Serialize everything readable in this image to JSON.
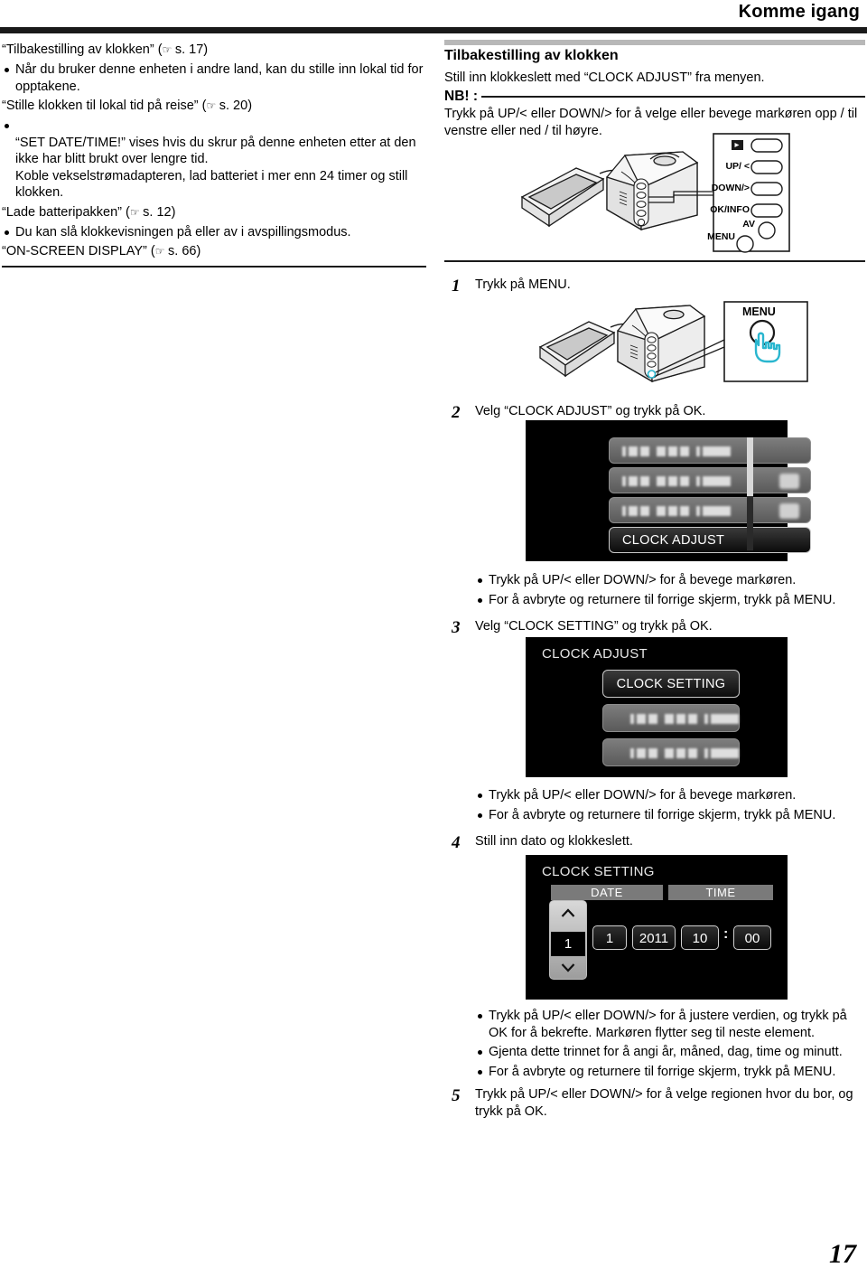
{
  "header": {
    "title": "Komme igang"
  },
  "left_column": {
    "refs": [
      {
        "text": "“Tilbakestilling av klokken” (",
        "page": "s. 17",
        "tail": ")"
      },
      {
        "text": "“Stille klokken til lokal tid på reise” (",
        "page": "s. 20",
        "tail": ")"
      },
      {
        "text": "“Lade batteripakken” (",
        "page": "s. 12",
        "tail": ")"
      },
      {
        "text": "“ON-SCREEN DISPLAY” (",
        "page": "s. 66",
        "tail": ")"
      }
    ],
    "bullets": [
      "Når du bruker denne enheten i andre land, kan du stille inn lokal tid for opptakene.",
      "“SET DATE/TIME!” vises hvis du skrur på denne enheten etter at den ikke har blitt brukt over lengre tid.\nKoble vekselstrømadapteren, lad batteriet i mer enn 24 timer og still klokken.",
      "Du kan slå klokkevisningen på eller av i avspillingsmodus."
    ]
  },
  "right_column": {
    "section_title": "Tilbakestilling av klokken",
    "section_sub": "Still inn klokkeslett med “CLOCK ADJUST” fra menyen.",
    "note_label": "NB! :",
    "note_text": "Trykk på UP/< eller DOWN/> for å velge eller bevege markøren opp / til venstre eller ned / til høyre.",
    "button_callouts": {
      "play": "▶",
      "up": "UP/ <",
      "down": "DOWN/>",
      "ok": "OK/INFO",
      "av": "AV",
      "menu": "MENU"
    },
    "menu_callout_label": "MENU"
  },
  "steps": [
    {
      "num": "1",
      "text": "Trykk på MENU."
    },
    {
      "num": "2",
      "text": "Velg “CLOCK ADJUST” og trykk på OK."
    },
    {
      "num": "3",
      "text": "Velg “CLOCK SETTING” og trykk på OK."
    },
    {
      "num": "4",
      "text": "Still inn dato og klokkeslett."
    },
    {
      "num": "5",
      "text": "Trykk på UP/< eller DOWN/> for å velge regionen hvor du bor, og trykk på OK."
    }
  ],
  "bullets_after_step2": [
    "Trykk på UP/< eller DOWN/> for å bevege markøren.",
    "For å avbryte og returnere til forrige skjerm, trykk på MENU."
  ],
  "bullets_after_step3": [
    "Trykk på UP/< eller DOWN/> for å bevege markøren.",
    "For å avbryte og returnere til forrige skjerm, trykk på MENU."
  ],
  "bullets_after_step4": [
    "Trykk på UP/< eller DOWN/> for å justere verdien, og trykk på OK for å bekrefte. Markøren flytter seg til neste element.",
    "Gjenta dette trinnet for å angi år, måned, dag, time og minutt.",
    "For å avbryte og returnere til forrige skjerm, trykk på MENU."
  ],
  "lcd_menu_screen": {
    "selected_item": "CLOCK ADJUST",
    "blurred_items_count": 3
  },
  "lcd_clock_adjust_screen": {
    "title": "CLOCK ADJUST",
    "selected_item": "CLOCK SETTING",
    "blurred_items_count": 2
  },
  "lcd_clock_setting_screen": {
    "title": "CLOCK SETTING",
    "date_label": "DATE",
    "time_label": "TIME",
    "day": "1",
    "month": "1",
    "year": "2011",
    "hour": "10",
    "minute": "00",
    "separator": ":"
  },
  "footer": {
    "page_number": "17"
  },
  "colors": {
    "accent_cyan": "#29b6cf",
    "rule_black": "#1a1a1a",
    "gray_bar": "#b8b8b8",
    "lcd_bg": "#000000"
  }
}
